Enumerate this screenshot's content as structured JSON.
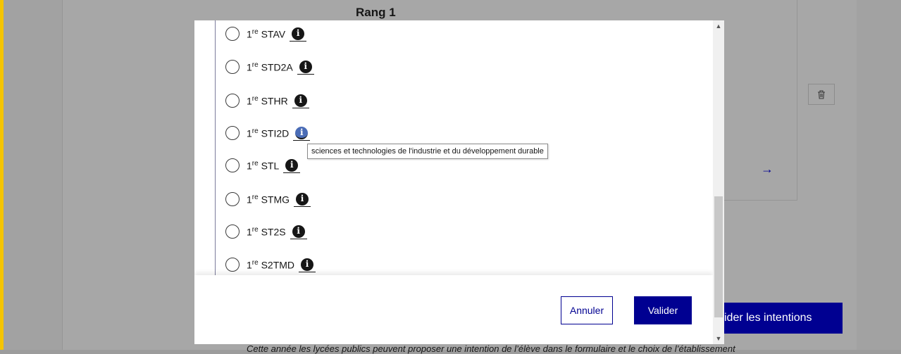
{
  "background": {
    "rank_heading": "Rang 1",
    "primary_button": "ider les intentions",
    "footer_text": "Cette année les lycées publics peuvent proposer une intention de l’élève dans le formulaire et le choix de l’établissement"
  },
  "options": [
    {
      "prefix": "1",
      "sup": "re",
      "name": "STAV"
    },
    {
      "prefix": "1",
      "sup": "re",
      "name": "STD2A"
    },
    {
      "prefix": "1",
      "sup": "re",
      "name": "STHR"
    },
    {
      "prefix": "1",
      "sup": "re",
      "name": "STI2D"
    },
    {
      "prefix": "1",
      "sup": "re",
      "name": "STL"
    },
    {
      "prefix": "1",
      "sup": "re",
      "name": "STMG"
    },
    {
      "prefix": "1",
      "sup": "re",
      "name": "ST2S"
    },
    {
      "prefix": "1",
      "sup": "re",
      "name": "S2TMD"
    }
  ],
  "tooltip": "sciences et technologies de l'industrie et du développement durable",
  "modal": {
    "cancel_label": "Annuler",
    "validate_label": "Valider"
  },
  "icons": {
    "info": "info-icon",
    "trash": "trash-icon",
    "arrow": "arrow-right-icon"
  },
  "colors": {
    "primary": "#000091",
    "accent_bar": "#f5c400",
    "info_hover": "#4a6cb6"
  }
}
